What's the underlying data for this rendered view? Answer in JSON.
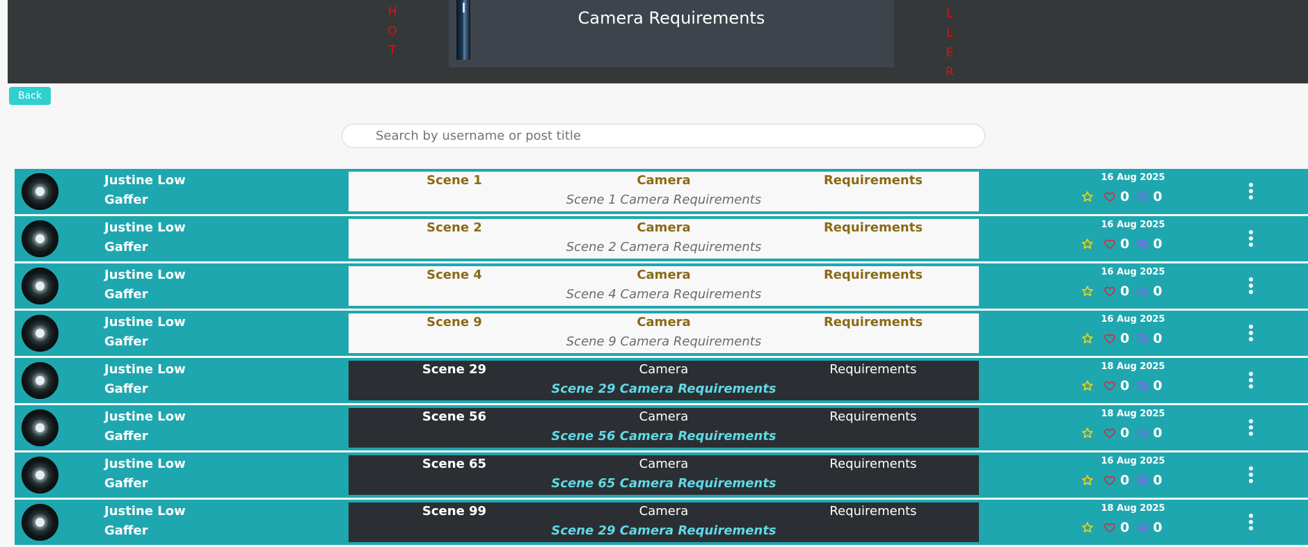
{
  "header": {
    "left_vertical_text": [
      "H",
      "O",
      "T"
    ],
    "right_vertical_text": [
      "L",
      "L",
      "E",
      "R"
    ],
    "title": "Camera Requirements"
  },
  "back_label": "Back",
  "search": {
    "placeholder": "Search by username or post title"
  },
  "colors": {
    "header_bg": "#353839",
    "row_bg": "#1fa7b0",
    "accent": "#2fd0cf",
    "vertical_text": "#e01010",
    "star": "#f2d313",
    "heart": "#e0223a",
    "comment": "#8f5cf7"
  },
  "icons": [
    "star-icon",
    "heart-icon",
    "comment-icon",
    "kebab-menu-icon"
  ],
  "posts": [
    {
      "theme": "light",
      "user": "Justine Low",
      "role": "Gaffer",
      "title": [
        "Scene 1",
        "Camera",
        "Requirements"
      ],
      "subtitle": "Scene 1 Camera Requirements",
      "date": "16 Aug 2025",
      "likes": "0",
      "comments": "0"
    },
    {
      "theme": "light",
      "user": "Justine Low",
      "role": "Gaffer",
      "title": [
        "Scene 2",
        "Camera",
        "Requirements"
      ],
      "subtitle": "Scene 2 Camera Requirements",
      "date": "16 Aug 2025",
      "likes": "0",
      "comments": "0"
    },
    {
      "theme": "light",
      "user": "Justine Low",
      "role": "Gaffer",
      "title": [
        "Scene 4",
        "Camera",
        "Requirements"
      ],
      "subtitle": "Scene 4 Camera Requirements",
      "date": "16 Aug 2025",
      "likes": "0",
      "comments": "0"
    },
    {
      "theme": "light",
      "user": "Justine Low",
      "role": "Gaffer",
      "title": [
        "Scene 9",
        "Camera",
        "Requirements"
      ],
      "subtitle": "Scene 9 Camera Requirements",
      "date": "16 Aug 2025",
      "likes": "0",
      "comments": "0"
    },
    {
      "theme": "dark",
      "user": "Justine Low",
      "role": "Gaffer",
      "title": [
        "Scene 29",
        "Camera",
        "Requirements"
      ],
      "subtitle": "Scene 29 Camera Requirements",
      "date": "18 Aug 2025",
      "likes": "0",
      "comments": "0"
    },
    {
      "theme": "dark",
      "user": "Justine Low",
      "role": "Gaffer",
      "title": [
        "Scene 56",
        "Camera",
        "Requirements"
      ],
      "subtitle": "Scene 56 Camera Requirements",
      "date": "18 Aug 2025",
      "likes": "0",
      "comments": "0"
    },
    {
      "theme": "dark",
      "user": "Justine Low",
      "role": "Gaffer",
      "title": [
        "Scene 65",
        "Camera",
        "Requirements"
      ],
      "subtitle": "Scene 65 Camera Requirements",
      "date": "16 Aug 2025",
      "likes": "0",
      "comments": "0"
    },
    {
      "theme": "dark",
      "user": "Justine Low",
      "role": "Gaffer",
      "title": [
        "Scene 99",
        "Camera",
        "Requirements"
      ],
      "subtitle": "Scene 29 Camera Requirements",
      "date": "18 Aug 2025",
      "likes": "0",
      "comments": "0"
    }
  ]
}
